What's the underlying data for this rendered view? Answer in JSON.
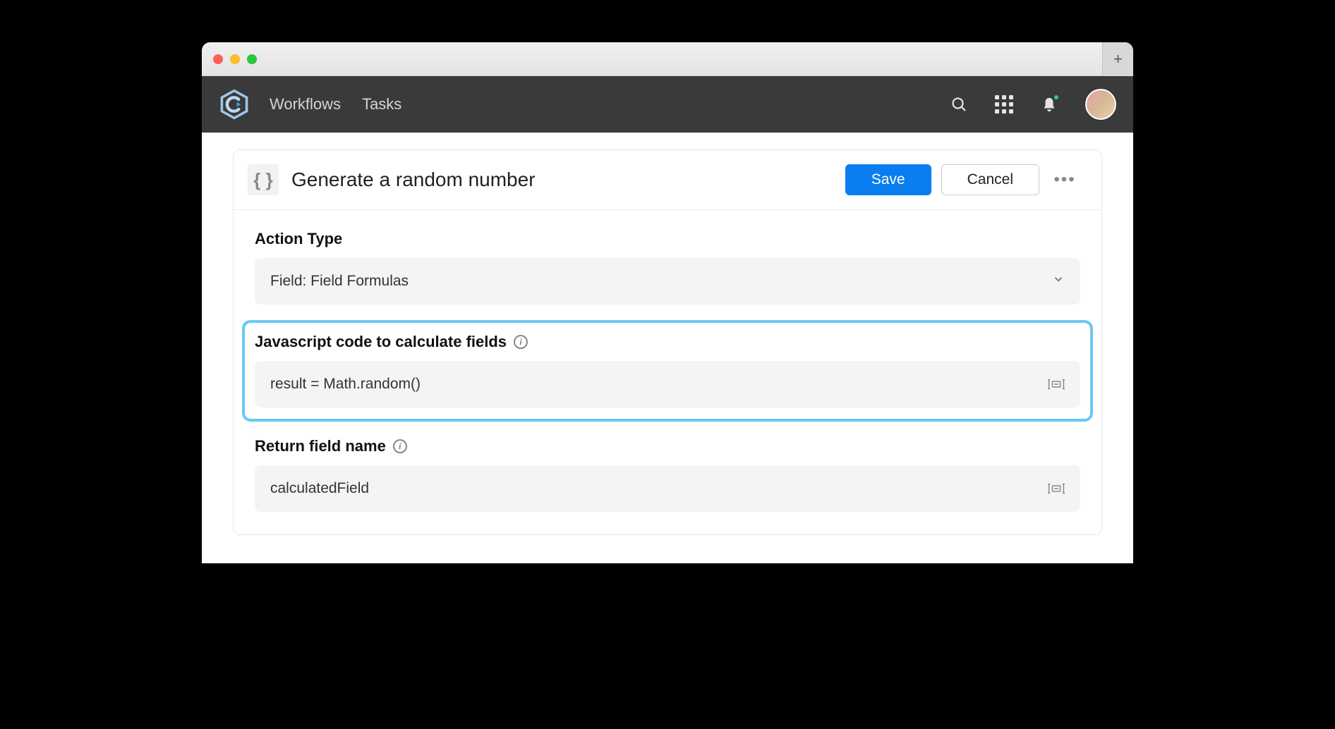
{
  "nav": {
    "workflows": "Workflows",
    "tasks": "Tasks"
  },
  "card": {
    "icon_text": "{ }",
    "title": "Generate a random number",
    "save": "Save",
    "cancel": "Cancel"
  },
  "sections": {
    "action_type": {
      "label": "Action Type",
      "value": "Field: Field Formulas"
    },
    "js_code": {
      "label": "Javascript code to calculate fields",
      "value": "result = Math.random()"
    },
    "return_field": {
      "label": "Return field name",
      "value": "calculatedField"
    }
  }
}
